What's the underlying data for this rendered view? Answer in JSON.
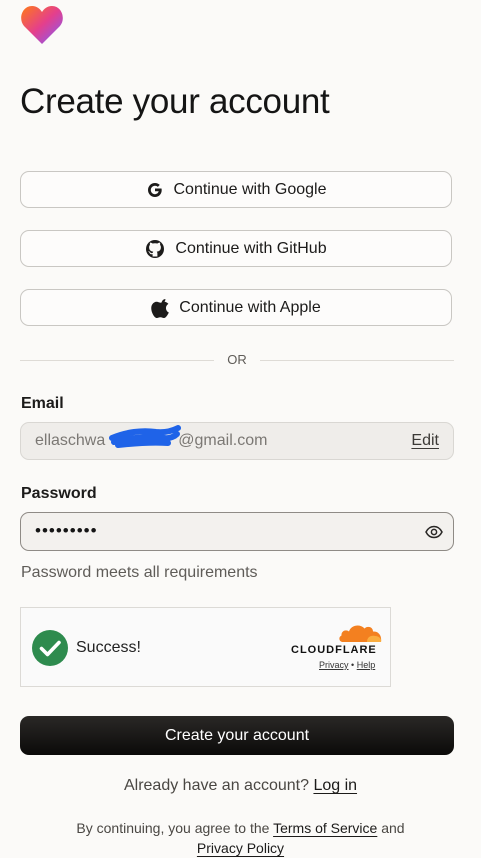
{
  "title": "Create your account",
  "sso": {
    "google": "Continue with Google",
    "github": "Continue with GitHub",
    "apple": "Continue with Apple"
  },
  "divider_text": "OR",
  "email": {
    "label": "Email",
    "value_start": "ellaschwa",
    "value_end": "@gmail.com",
    "edit_label": "Edit"
  },
  "password": {
    "label": "Password",
    "masked_value": "•••••••••",
    "hint": "Password meets all requirements",
    "icon": "eye-icon"
  },
  "captcha": {
    "status": "Success!",
    "brand": "CLOUDFLARE",
    "privacy": "Privacy",
    "separator": "•",
    "help": "Help"
  },
  "submit_label": "Create your account",
  "login_prompt": {
    "text": "Already have an account?",
    "link": "Log in"
  },
  "terms": {
    "prefix": "By continuing, you agree to the",
    "tos": "Terms of Service",
    "and": "and",
    "privacy": "Privacy Policy"
  },
  "colors": {
    "accent_gradient": [
      "#ff7a18",
      "#e43f8c",
      "#7b5cff"
    ],
    "success_green": "#2e8b4e",
    "cloudflare_orange": "#f38020",
    "primary_button": "#0b0a09"
  }
}
